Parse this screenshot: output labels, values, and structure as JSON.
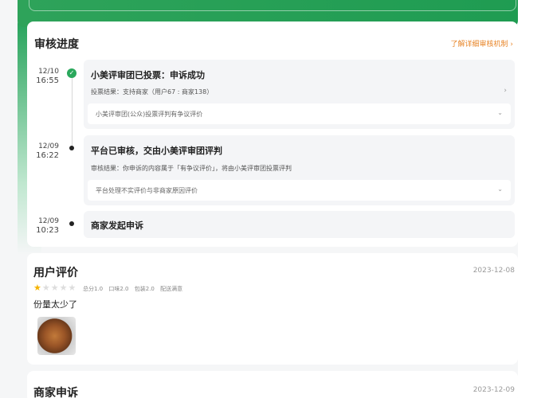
{
  "progress": {
    "title": "审核进度",
    "link_label": "了解详细审核机制",
    "link_arrow": "›",
    "entries": [
      {
        "date": "12/10",
        "time": "16:55",
        "title": "小美评审团已投票：申诉成功",
        "line": "投票结果：支持商家（用户67 : 商家138）",
        "line_arrow": "›",
        "sub": "小美评审团(公众)投票评判有争议评价",
        "sub_chevron": "⌄"
      },
      {
        "date": "12/09",
        "time": "16:22",
        "title": "平台已审核，交由小美评审团评判",
        "line": "审核结果：你申诉的内容属于「有争议评价」，将由小美评审团投票评判",
        "sub": "平台处理不实评价与非商家原因评价",
        "sub_chevron": "⌄"
      },
      {
        "date": "12/09",
        "time": "10:23",
        "title": "商家发起申诉"
      }
    ]
  },
  "review": {
    "title": "用户评价",
    "date": "2023-12-08",
    "rating": 1,
    "max_rating": 5,
    "scores": [
      "总分1.0",
      "口味2.0",
      "包装2.0",
      "配送满意"
    ],
    "text": "份量太少了",
    "star_color": "#f5b301"
  },
  "appeal": {
    "title": "商家申诉",
    "date": "2023-12-09"
  },
  "colors": {
    "brand_green": "#22a158",
    "link_orange": "#e8862a",
    "check_green": "#2aa85c"
  }
}
